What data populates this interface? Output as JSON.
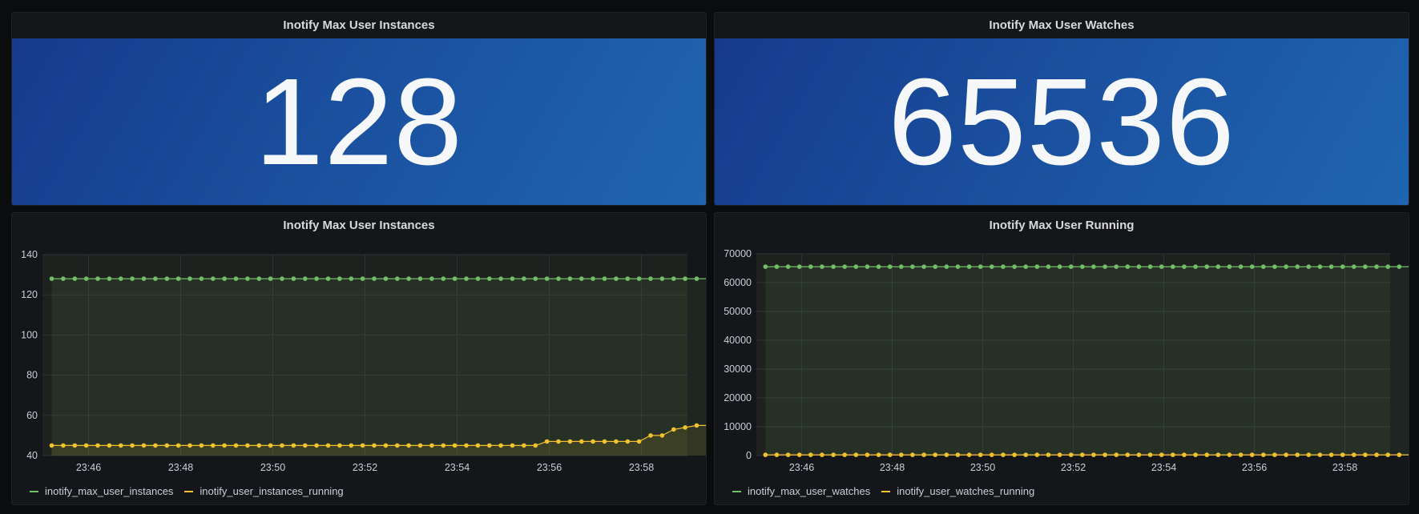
{
  "colors": {
    "green": "#73bf69",
    "yellow": "#f2c12e",
    "grid": "#2c3235",
    "plot_bg": "#1e211e"
  },
  "stat_panels": [
    {
      "title": "Inotify Max User Instances",
      "value": "128"
    },
    {
      "title": "Inotify Max User Watches",
      "value": "65536"
    }
  ],
  "graph_panels": [
    {
      "title": "Inotify Max User Instances",
      "legend": [
        {
          "label": "inotify_max_user_instances",
          "color": "#73bf69"
        },
        {
          "label": "inotify_user_instances_running",
          "color": "#f2c12e"
        }
      ]
    },
    {
      "title": "Inotify Max User Running",
      "legend": [
        {
          "label": "inotify_max_user_watches",
          "color": "#73bf69"
        },
        {
          "label": "inotify_user_watches_running",
          "color": "#f2c12e"
        }
      ]
    }
  ],
  "chart_data": [
    {
      "type": "line",
      "title": "Inotify Max User Instances",
      "xlabel": "",
      "ylabel": "",
      "x_ticks": [
        "23:46",
        "23:48",
        "23:50",
        "23:52",
        "23:54",
        "23:56",
        "23:58"
      ],
      "x_range_minutes": [
        45.0,
        59.0
      ],
      "y_ticks": [
        40,
        60,
        80,
        100,
        120,
        140
      ],
      "ylim": [
        40,
        140
      ],
      "grid": true,
      "legend_position": "bottom-left",
      "series": [
        {
          "name": "inotify_max_user_instances",
          "color": "#73bf69",
          "x_start_minute": 45.2,
          "x_step_minute": 0.25,
          "values": [
            128,
            128,
            128,
            128,
            128,
            128,
            128,
            128,
            128,
            128,
            128,
            128,
            128,
            128,
            128,
            128,
            128,
            128,
            128,
            128,
            128,
            128,
            128,
            128,
            128,
            128,
            128,
            128,
            128,
            128,
            128,
            128,
            128,
            128,
            128,
            128,
            128,
            128,
            128,
            128,
            128,
            128,
            128,
            128,
            128,
            128,
            128,
            128,
            128,
            128,
            128,
            128,
            128,
            128,
            128,
            128,
            128,
            128,
            128,
            128,
            128
          ]
        },
        {
          "name": "inotify_user_instances_running",
          "color": "#f2c12e",
          "x_start_minute": 45.2,
          "x_step_minute": 0.25,
          "values": [
            45,
            45,
            45,
            45,
            45,
            45,
            45,
            45,
            45,
            45,
            45,
            45,
            45,
            45,
            45,
            45,
            45,
            45,
            45,
            45,
            45,
            45,
            45,
            45,
            45,
            45,
            45,
            45,
            45,
            45,
            45,
            45,
            45,
            45,
            45,
            45,
            45,
            45,
            45,
            45,
            45,
            45,
            45,
            47,
            47,
            47,
            47,
            47,
            47,
            47,
            47,
            47,
            50,
            50,
            53,
            54,
            55,
            55,
            55,
            55,
            55
          ]
        }
      ]
    },
    {
      "type": "line",
      "title": "Inotify Max User Running",
      "xlabel": "",
      "ylabel": "",
      "x_ticks": [
        "23:46",
        "23:48",
        "23:50",
        "23:52",
        "23:54",
        "23:56",
        "23:58"
      ],
      "x_range_minutes": [
        45.0,
        59.0
      ],
      "y_ticks": [
        0,
        10000,
        20000,
        30000,
        40000,
        50000,
        60000,
        70000
      ],
      "ylim": [
        0,
        70000
      ],
      "grid": true,
      "legend_position": "bottom-left",
      "series": [
        {
          "name": "inotify_max_user_watches",
          "color": "#73bf69",
          "x_start_minute": 45.2,
          "x_step_minute": 0.25,
          "values": [
            65536,
            65536,
            65536,
            65536,
            65536,
            65536,
            65536,
            65536,
            65536,
            65536,
            65536,
            65536,
            65536,
            65536,
            65536,
            65536,
            65536,
            65536,
            65536,
            65536,
            65536,
            65536,
            65536,
            65536,
            65536,
            65536,
            65536,
            65536,
            65536,
            65536,
            65536,
            65536,
            65536,
            65536,
            65536,
            65536,
            65536,
            65536,
            65536,
            65536,
            65536,
            65536,
            65536,
            65536,
            65536,
            65536,
            65536,
            65536,
            65536,
            65536,
            65536,
            65536,
            65536,
            65536,
            65536,
            65536,
            65536,
            65536,
            65536,
            65536,
            65536
          ]
        },
        {
          "name": "inotify_user_watches_running",
          "color": "#f2c12e",
          "x_start_minute": 45.2,
          "x_step_minute": 0.25,
          "values": [
            250,
            250,
            250,
            250,
            250,
            250,
            250,
            250,
            250,
            250,
            250,
            250,
            250,
            250,
            250,
            250,
            250,
            250,
            250,
            250,
            250,
            250,
            250,
            250,
            250,
            250,
            250,
            250,
            250,
            250,
            250,
            250,
            250,
            250,
            250,
            250,
            250,
            250,
            250,
            250,
            250,
            250,
            250,
            250,
            250,
            250,
            250,
            250,
            250,
            250,
            250,
            250,
            250,
            250,
            250,
            250,
            250,
            250,
            250,
            250,
            250
          ]
        }
      ]
    }
  ]
}
